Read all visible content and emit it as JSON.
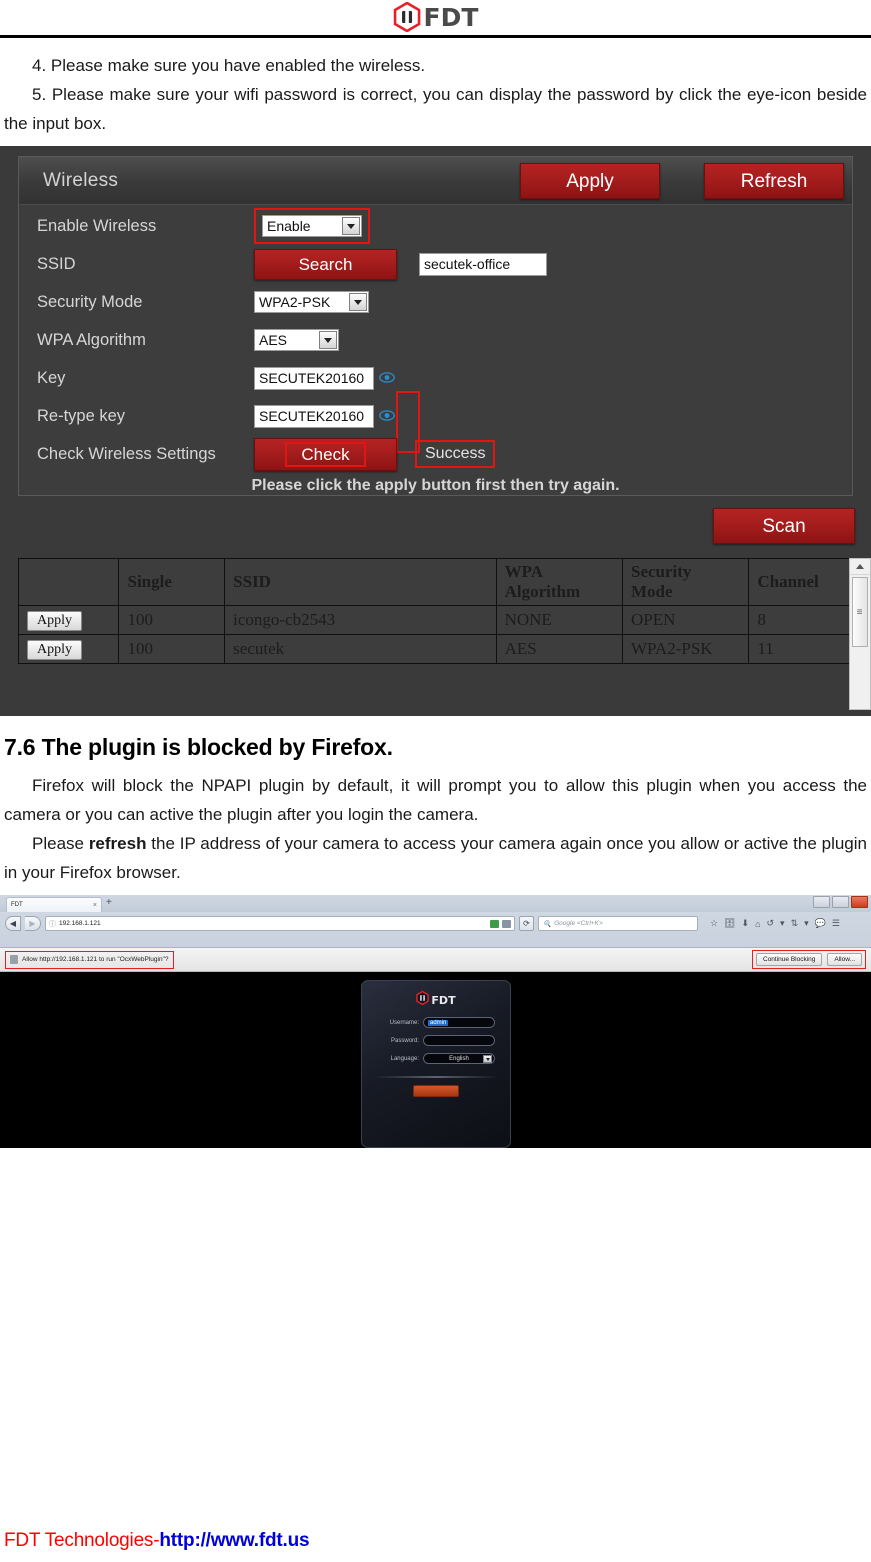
{
  "header": {
    "logo_text": "FDT",
    "logo_icon": "fdt-hexagon-logo"
  },
  "doc": {
    "item4": "4. Please make sure you have enabled the wireless.",
    "item5": "5. Please make sure your wifi password is correct, you can display the password by click the eye-icon beside the input box.",
    "section_title": "7.6 The plugin is blocked by Firefox.",
    "para1": "Firefox will block the NPAPI plugin by default, it will prompt you to allow this plugin when you access the camera or you can active the plugin after you login the camera.",
    "para2_pre": "Please ",
    "para2_bold": "refresh",
    "para2_post": " the IP address of your camera to access your camera again once you allow or active the plugin in your Firefox browser."
  },
  "wireless": {
    "title": "Wireless",
    "apply_label": "Apply",
    "refresh_label": "Refresh",
    "scan_label": "Scan",
    "hint": "Please click the apply button first then try again.",
    "rows": {
      "enable_wireless_label": "Enable Wireless",
      "enable_wireless_value": "Enable",
      "ssid_label": "SSID",
      "ssid_search_label": "Search",
      "ssid_value": "secutek-office",
      "security_mode_label": "Security Mode",
      "security_mode_value": "WPA2-PSK",
      "wpa_algorithm_label": "WPA Algorithm",
      "wpa_algorithm_value": "AES",
      "key_label": "Key",
      "key_value": "SECUTEK20160",
      "retype_key_label": "Re-type key",
      "retype_key_value": "SECUTEK20160",
      "check_label": "Check Wireless Settings",
      "check_button_label": "Check",
      "check_status": "Success"
    },
    "table": {
      "headers": [
        "",
        "Single",
        "SSID",
        "WPA Algorithm",
        "Security Mode",
        "Channel"
      ],
      "header_wpa_l1": "WPA",
      "header_wpa_l2": "Algorithm",
      "header_sec_l1": "Security",
      "header_sec_l2": "Mode",
      "rows": [
        {
          "apply": "Apply",
          "single": "100",
          "ssid": "icongo-cb2543",
          "wpa": "NONE",
          "security": "OPEN",
          "channel": "8"
        },
        {
          "apply": "Apply",
          "single": "100",
          "ssid": "secutek",
          "wpa": "AES",
          "security": "WPA2-PSK",
          "channel": "11"
        }
      ]
    },
    "colors": {
      "accent_red": "#a51d1d",
      "panel_bg": "#3d3d3d",
      "highlight_box": "#e21515"
    }
  },
  "firefox": {
    "tab_title": "FDT",
    "tab_close": "×",
    "new_tab": "+",
    "url_value": "192.168.1.121",
    "search_placeholder": "Google <Ctrl+K>",
    "notification_text": "Allow http://192.168.1.121 to run \"OcxWebPlugin\"?",
    "continue_blocking_label": "Continue Blocking",
    "allow_label": "Allow...",
    "login": {
      "logo_text": "FDT",
      "username_label": "Username:",
      "username_value": "admin",
      "password_label": "Password:",
      "password_value": "",
      "language_label": "Language:",
      "language_value": "English"
    }
  },
  "footer": {
    "company": "FDT Technologies-",
    "url": "http://www.fdt.us"
  }
}
